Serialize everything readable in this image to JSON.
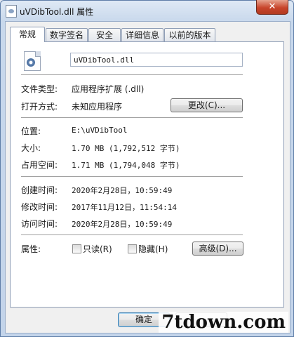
{
  "window": {
    "title": "uVDibTool.dll 属性",
    "close_label": "✕"
  },
  "tabs": [
    {
      "label": "常规"
    },
    {
      "label": "数字签名"
    },
    {
      "label": "安全"
    },
    {
      "label": "详细信息"
    },
    {
      "label": "以前的版本"
    }
  ],
  "general": {
    "file_name": "uVDibTool.dll",
    "file_type_label": "文件类型:",
    "file_type_value": "应用程序扩展 (.dll)",
    "opens_with_label": "打开方式:",
    "opens_with_value": "未知应用程序",
    "change_button": "更改(C)...",
    "location_label": "位置:",
    "location_value": "E:\\uVDibTool",
    "size_label": "大小:",
    "size_value": "1.70 MB (1,792,512 字节)",
    "size_on_disk_label": "占用空间:",
    "size_on_disk_value": "1.71 MB (1,794,048 字节)",
    "created_label": "创建时间:",
    "created_value": "2020年2月28日，10:59:49",
    "modified_label": "修改时间:",
    "modified_value": "2017年11月12日，11:54:14",
    "accessed_label": "访问时间:",
    "accessed_value": "2020年2月28日，10:59:49",
    "attributes_label": "属性:",
    "readonly_label": "只读(R)",
    "hidden_label": "隐藏(H)",
    "advanced_button": "高级(D)..."
  },
  "footer": {
    "ok_button": "确定"
  },
  "watermark": "7tdown.com"
}
